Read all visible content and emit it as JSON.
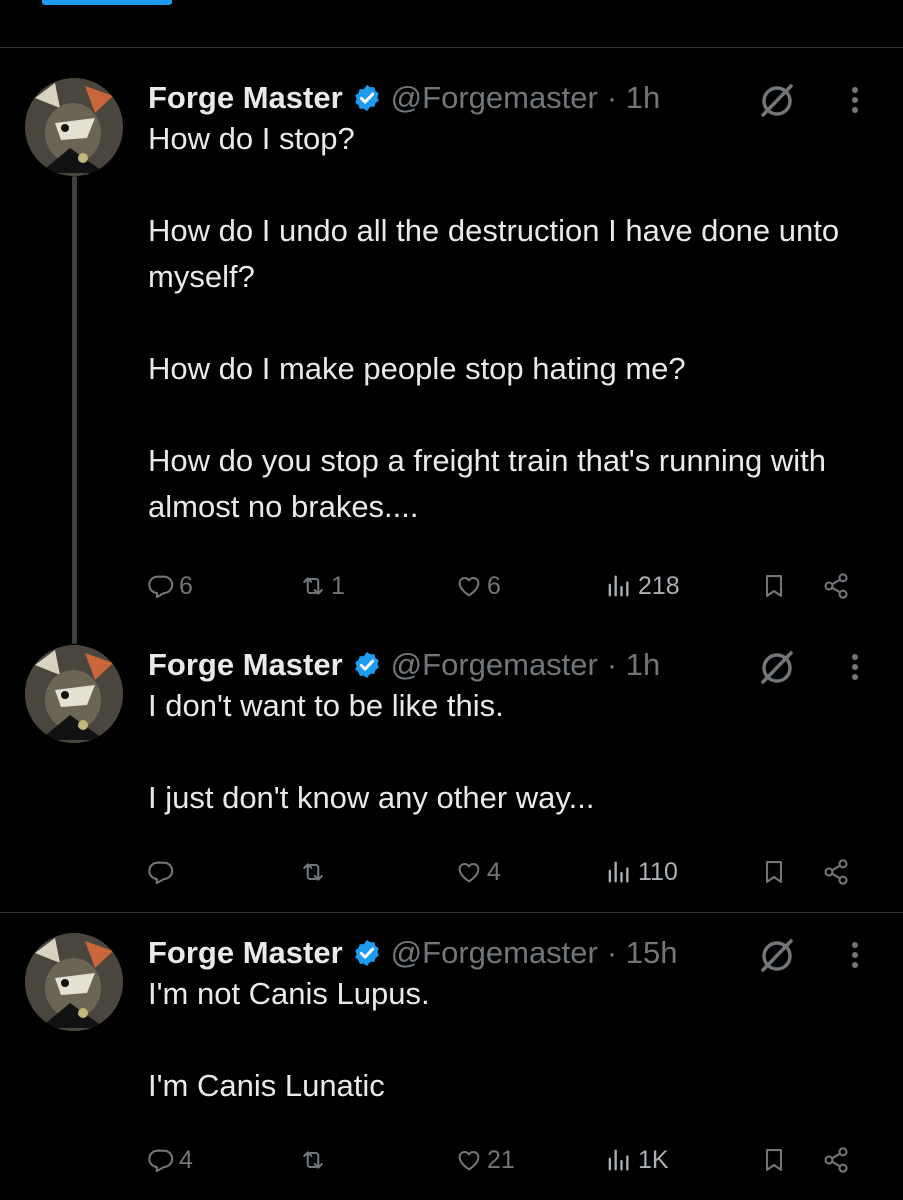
{
  "tweets": [
    {
      "author": "Forge Master",
      "handle": "@Forgemaster",
      "time": "· 1h",
      "paragraphs": [
        "How do I stop?",
        "How do I undo all the destruction I have done unto myself?",
        "How do I make people stop hating me?",
        "How do you stop a freight train that's running with almost no brakes...."
      ],
      "stats": {
        "replies": "6",
        "reposts": "1",
        "likes": "6",
        "views": "218"
      }
    },
    {
      "author": "Forge Master",
      "handle": "@Forgemaster",
      "time": "· 1h",
      "paragraphs": [
        "I don't want to be like this.",
        "I just don't know any other way..."
      ],
      "stats": {
        "replies": "",
        "reposts": "",
        "likes": "4",
        "views": "110"
      }
    },
    {
      "author": "Forge Master",
      "handle": "@Forgemaster",
      "time": "· 15h",
      "paragraphs": [
        "I'm not Canis Lupus.",
        "I'm Canis Lunatic"
      ],
      "stats": {
        "replies": "4",
        "reposts": "",
        "likes": "21",
        "views": "1K"
      }
    }
  ],
  "icons": [
    "verified-badge-icon",
    "grok-icon",
    "more-icon",
    "reply-icon",
    "repost-icon",
    "like-icon",
    "views-icon",
    "bookmark-icon",
    "share-icon"
  ],
  "colors": {
    "accent": "#1d9bf0",
    "background": "#000000",
    "text": "#e7e9ea",
    "muted": "#71767b"
  }
}
